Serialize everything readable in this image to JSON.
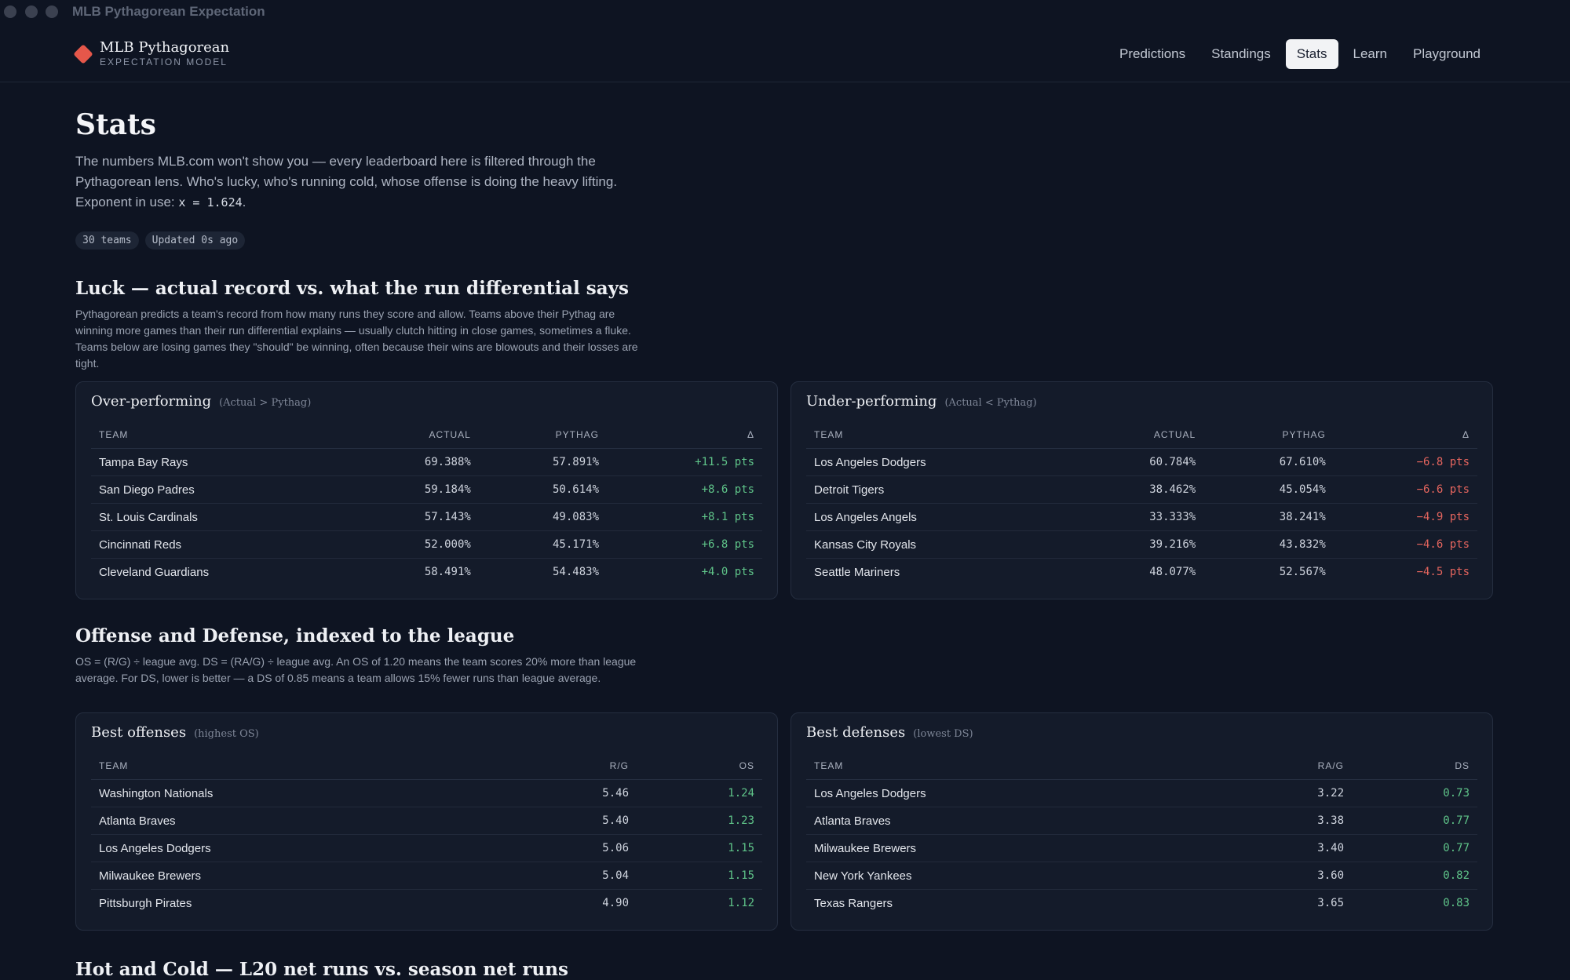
{
  "window": {
    "title": "MLB Pythagorean Expectation"
  },
  "brand": {
    "title": "MLB Pythagorean",
    "subtitle": "EXPECTATION MODEL"
  },
  "nav": [
    "Predictions",
    "Standings",
    "Stats",
    "Learn",
    "Playground"
  ],
  "nav_active": "Stats",
  "page": {
    "title": "Stats",
    "intro_1": "The numbers MLB.com won't show you — every leaderboard here is filtered through the Pythagorean lens. Who's lucky, who's running cold, whose offense is doing the heavy lifting.",
    "intro_2_prefix": "Exponent in use: ",
    "exponent": "x = 1.624",
    "intro_2_suffix": ".",
    "chips": [
      "30 teams",
      "Updated 0s ago"
    ]
  },
  "luck": {
    "title": "Luck — actual record vs. what the run differential says",
    "desc": "Pythagorean predicts a team's record from how many runs they score and allow. Teams above their Pythag are winning more games than their run differential explains — usually clutch hitting in close games, sometimes a fluke. Teams below are losing games they \"should\" be winning, often because their wins are blowouts and their losses are tight.",
    "headers": [
      "TEAM",
      "ACTUAL",
      "PYTHAG",
      "Δ"
    ],
    "over": {
      "title": "Over-performing",
      "note": "(Actual > Pythag)",
      "rows": [
        [
          "Tampa Bay Rays",
          "69.388%",
          "57.891%",
          "+11.5 pts"
        ],
        [
          "San Diego Padres",
          "59.184%",
          "50.614%",
          "+8.6 pts"
        ],
        [
          "St. Louis Cardinals",
          "57.143%",
          "49.083%",
          "+8.1 pts"
        ],
        [
          "Cincinnati Reds",
          "52.000%",
          "45.171%",
          "+6.8 pts"
        ],
        [
          "Cleveland Guardians",
          "58.491%",
          "54.483%",
          "+4.0 pts"
        ]
      ]
    },
    "under": {
      "title": "Under-performing",
      "note": "(Actual < Pythag)",
      "rows": [
        [
          "Los Angeles Dodgers",
          "60.784%",
          "67.610%",
          "−6.8 pts"
        ],
        [
          "Detroit Tigers",
          "38.462%",
          "45.054%",
          "−6.6 pts"
        ],
        [
          "Los Angeles Angels",
          "33.333%",
          "38.241%",
          "−4.9 pts"
        ],
        [
          "Kansas City Royals",
          "39.216%",
          "43.832%",
          "−4.6 pts"
        ],
        [
          "Seattle Mariners",
          "48.077%",
          "52.567%",
          "−4.5 pts"
        ]
      ]
    }
  },
  "offdef": {
    "title": "Offense and Defense, indexed to the league",
    "desc": "OS = (R/G) ÷ league avg. DS = (RA/G) ÷ league avg. An OS of 1.20 means the team scores 20% more than league average. For DS, lower is better — a DS of 0.85 means a team allows 15% fewer runs than league average.",
    "offense": {
      "title": "Best offenses",
      "note": "(highest OS)",
      "headers": [
        "TEAM",
        "R/G",
        "OS"
      ],
      "rows": [
        [
          "Washington Nationals",
          "5.46",
          "1.24"
        ],
        [
          "Atlanta Braves",
          "5.40",
          "1.23"
        ],
        [
          "Los Angeles Dodgers",
          "5.06",
          "1.15"
        ],
        [
          "Milwaukee Brewers",
          "5.04",
          "1.15"
        ],
        [
          "Pittsburgh Pirates",
          "4.90",
          "1.12"
        ]
      ]
    },
    "defense": {
      "title": "Best defenses",
      "note": "(lowest DS)",
      "headers": [
        "TEAM",
        "RA/G",
        "DS"
      ],
      "rows": [
        [
          "Los Angeles Dodgers",
          "3.22",
          "0.73"
        ],
        [
          "Atlanta Braves",
          "3.38",
          "0.77"
        ],
        [
          "Milwaukee Brewers",
          "3.40",
          "0.77"
        ],
        [
          "New York Yankees",
          "3.60",
          "0.82"
        ],
        [
          "Texas Rangers",
          "3.65",
          "0.83"
        ]
      ]
    }
  },
  "hotcold": {
    "title": "Hot and Cold — L20 net runs vs. season net runs"
  },
  "colors": {
    "accent": "#e5574a",
    "positive": "#5fc489",
    "negative": "#e5655e",
    "background": "#0e1422"
  }
}
